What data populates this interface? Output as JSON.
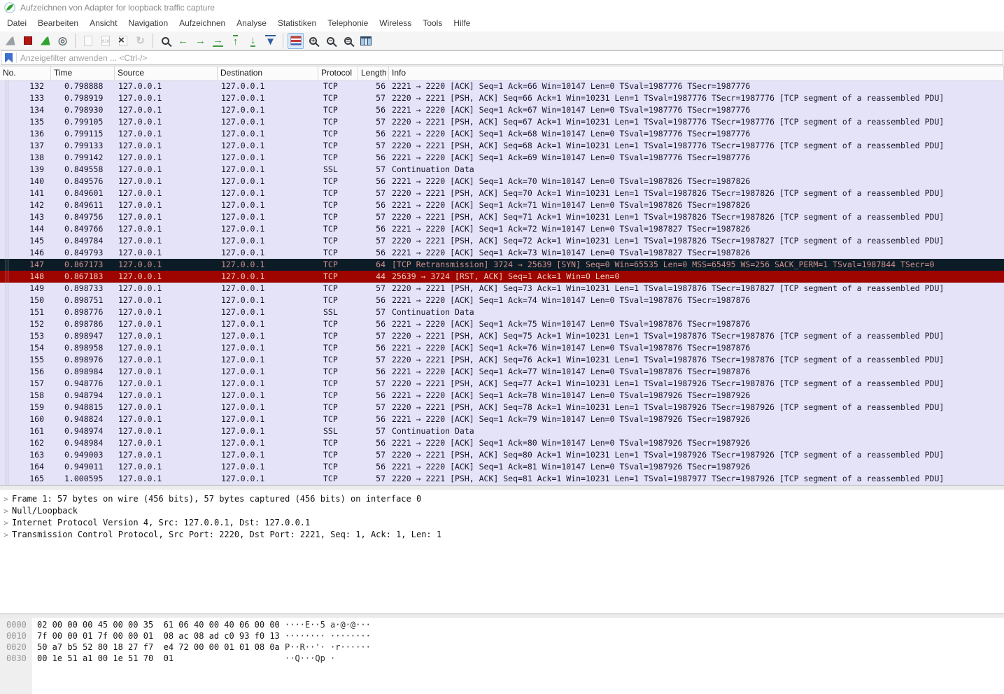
{
  "window": {
    "title": "Aufzeichnen von Adapter for loopback traffic capture"
  },
  "menu": {
    "items": [
      "Datei",
      "Bearbeiten",
      "Ansicht",
      "Navigation",
      "Aufzeichnen",
      "Analyse",
      "Statistiken",
      "Telephonie",
      "Wireless",
      "Tools",
      "Hilfe"
    ]
  },
  "toolbar": {
    "items": [
      {
        "name": "start-capture-icon",
        "kind": "fin",
        "color": "#9aa0a8",
        "enabled": false
      },
      {
        "name": "stop-capture-icon",
        "kind": "square",
        "color": "#b41414",
        "enabled": true
      },
      {
        "name": "restart-capture-icon",
        "kind": "fin",
        "color": "#2fa52f",
        "enabled": true
      },
      {
        "name": "capture-options-icon",
        "kind": "glyph",
        "glyph": "◎",
        "color": "#5f6b72",
        "enabled": true
      },
      {
        "kind": "sep"
      },
      {
        "name": "open-file-icon",
        "kind": "doc",
        "enabled": false
      },
      {
        "name": "save-file-icon",
        "kind": "doc010",
        "glyph": "010",
        "enabled": false
      },
      {
        "name": "close-file-icon",
        "kind": "docx",
        "glyph": "×",
        "enabled": true
      },
      {
        "name": "reload-file-icon",
        "kind": "glyph",
        "glyph": "↻",
        "color": "#c2c6ca",
        "enabled": false
      },
      {
        "kind": "sep"
      },
      {
        "name": "find-packet-icon",
        "kind": "mag",
        "glyph": "",
        "color": "#33383d",
        "enabled": true
      },
      {
        "name": "go-back-icon",
        "kind": "glyph",
        "glyph": "←",
        "color": "#3c9b3c",
        "enabled": true
      },
      {
        "name": "go-forward-icon",
        "kind": "glyph",
        "glyph": "→",
        "color": "#3c9b3c",
        "enabled": true
      },
      {
        "name": "go-to-packet-icon",
        "kind": "glyph",
        "glyph": "→",
        "color": "#3c9b3c",
        "bar": "bottom",
        "enabled": true
      },
      {
        "name": "first-packet-icon",
        "kind": "glyph",
        "glyph": "↑",
        "color": "#3c9b3c",
        "bar": "top",
        "enabled": true
      },
      {
        "name": "last-packet-icon",
        "kind": "glyph",
        "glyph": "↓",
        "color": "#3c9b3c",
        "bar": "bottom",
        "enabled": true
      },
      {
        "name": "auto-scroll-icon",
        "kind": "glyph",
        "glyph": "▼",
        "color": "#2f5e9e",
        "bar": "top",
        "enabled": true
      },
      {
        "kind": "sep"
      },
      {
        "name": "colorize-packets-icon",
        "kind": "lines",
        "active": true,
        "enabled": true
      },
      {
        "name": "zoom-in-icon",
        "kind": "mag",
        "glyph": "+",
        "color": "#33383d",
        "enabled": true
      },
      {
        "name": "zoom-out-icon",
        "kind": "mag",
        "glyph": "−",
        "color": "#33383d",
        "enabled": true
      },
      {
        "name": "zoom-original-icon",
        "kind": "mag",
        "glyph": "=",
        "color": "#33383d",
        "enabled": true
      },
      {
        "name": "resize-columns-icon",
        "kind": "grid",
        "enabled": true
      }
    ]
  },
  "filter": {
    "placeholder": "Anzeigefilter anwenden ... <Ctrl-/>"
  },
  "accents": {
    "row_default_bg": "#e4e3f7",
    "row_bad_bg": "#0c1c26",
    "row_bad_fg": "#cf8e8e",
    "row_rst_bg": "#9e0400",
    "row_rst_fg": "#f4cdbc"
  },
  "packet_list": {
    "columns": [
      {
        "label": "No."
      },
      {
        "label": "Time"
      },
      {
        "label": "Source"
      },
      {
        "label": "Destination"
      },
      {
        "label": "Protocol"
      },
      {
        "label": "Length"
      },
      {
        "label": "Info"
      }
    ],
    "packets": [
      {
        "no": "132",
        "time": "0.798888",
        "src": "127.0.0.1",
        "dst": "127.0.0.1",
        "proto": "TCP",
        "len": "56",
        "info": "2221 → 2220 [ACK] Seq=1 Ack=66 Win=10147 Len=0 TSval=1987776 TSecr=1987776",
        "type": "tcp"
      },
      {
        "no": "133",
        "time": "0.798919",
        "src": "127.0.0.1",
        "dst": "127.0.0.1",
        "proto": "TCP",
        "len": "57",
        "info": "2220 → 2221 [PSH, ACK] Seq=66 Ack=1 Win=10231 Len=1 TSval=1987776 TSecr=1987776 [TCP segment of a reassembled PDU]",
        "type": "tcp"
      },
      {
        "no": "134",
        "time": "0.798930",
        "src": "127.0.0.1",
        "dst": "127.0.0.1",
        "proto": "TCP",
        "len": "56",
        "info": "2221 → 2220 [ACK] Seq=1 Ack=67 Win=10147 Len=0 TSval=1987776 TSecr=1987776",
        "type": "tcp"
      },
      {
        "no": "135",
        "time": "0.799105",
        "src": "127.0.0.1",
        "dst": "127.0.0.1",
        "proto": "TCP",
        "len": "57",
        "info": "2220 → 2221 [PSH, ACK] Seq=67 Ack=1 Win=10231 Len=1 TSval=1987776 TSecr=1987776 [TCP segment of a reassembled PDU]",
        "type": "tcp"
      },
      {
        "no": "136",
        "time": "0.799115",
        "src": "127.0.0.1",
        "dst": "127.0.0.1",
        "proto": "TCP",
        "len": "56",
        "info": "2221 → 2220 [ACK] Seq=1 Ack=68 Win=10147 Len=0 TSval=1987776 TSecr=1987776",
        "type": "tcp"
      },
      {
        "no": "137",
        "time": "0.799133",
        "src": "127.0.0.1",
        "dst": "127.0.0.1",
        "proto": "TCP",
        "len": "57",
        "info": "2220 → 2221 [PSH, ACK] Seq=68 Ack=1 Win=10231 Len=1 TSval=1987776 TSecr=1987776 [TCP segment of a reassembled PDU]",
        "type": "tcp"
      },
      {
        "no": "138",
        "time": "0.799142",
        "src": "127.0.0.1",
        "dst": "127.0.0.1",
        "proto": "TCP",
        "len": "56",
        "info": "2221 → 2220 [ACK] Seq=1 Ack=69 Win=10147 Len=0 TSval=1987776 TSecr=1987776",
        "type": "tcp"
      },
      {
        "no": "139",
        "time": "0.849558",
        "src": "127.0.0.1",
        "dst": "127.0.0.1",
        "proto": "SSL",
        "len": "57",
        "info": "Continuation Data",
        "type": "ssl"
      },
      {
        "no": "140",
        "time": "0.849576",
        "src": "127.0.0.1",
        "dst": "127.0.0.1",
        "proto": "TCP",
        "len": "56",
        "info": "2221 → 2220 [ACK] Seq=1 Ack=70 Win=10147 Len=0 TSval=1987826 TSecr=1987826",
        "type": "tcp"
      },
      {
        "no": "141",
        "time": "0.849601",
        "src": "127.0.0.1",
        "dst": "127.0.0.1",
        "proto": "TCP",
        "len": "57",
        "info": "2220 → 2221 [PSH, ACK] Seq=70 Ack=1 Win=10231 Len=1 TSval=1987826 TSecr=1987826 [TCP segment of a reassembled PDU]",
        "type": "tcp"
      },
      {
        "no": "142",
        "time": "0.849611",
        "src": "127.0.0.1",
        "dst": "127.0.0.1",
        "proto": "TCP",
        "len": "56",
        "info": "2221 → 2220 [ACK] Seq=1 Ack=71 Win=10147 Len=0 TSval=1987826 TSecr=1987826",
        "type": "tcp"
      },
      {
        "no": "143",
        "time": "0.849756",
        "src": "127.0.0.1",
        "dst": "127.0.0.1",
        "proto": "TCP",
        "len": "57",
        "info": "2220 → 2221 [PSH, ACK] Seq=71 Ack=1 Win=10231 Len=1 TSval=1987826 TSecr=1987826 [TCP segment of a reassembled PDU]",
        "type": "tcp"
      },
      {
        "no": "144",
        "time": "0.849766",
        "src": "127.0.0.1",
        "dst": "127.0.0.1",
        "proto": "TCP",
        "len": "56",
        "info": "2221 → 2220 [ACK] Seq=1 Ack=72 Win=10147 Len=0 TSval=1987827 TSecr=1987826",
        "type": "tcp"
      },
      {
        "no": "145",
        "time": "0.849784",
        "src": "127.0.0.1",
        "dst": "127.0.0.1",
        "proto": "TCP",
        "len": "57",
        "info": "2220 → 2221 [PSH, ACK] Seq=72 Ack=1 Win=10231 Len=1 TSval=1987826 TSecr=1987827 [TCP segment of a reassembled PDU]",
        "type": "tcp"
      },
      {
        "no": "146",
        "time": "0.849793",
        "src": "127.0.0.1",
        "dst": "127.0.0.1",
        "proto": "TCP",
        "len": "56",
        "info": "2221 → 2220 [ACK] Seq=1 Ack=73 Win=10147 Len=0 TSval=1987827 TSecr=1987826",
        "type": "tcp"
      },
      {
        "no": "147",
        "time": "0.867173",
        "src": "127.0.0.1",
        "dst": "127.0.0.1",
        "proto": "TCP",
        "len": "64",
        "info": "[TCP Retransmission] 3724 → 25639 [SYN] Seq=0 Win=65535 Len=0 MSS=65495 WS=256 SACK_PERM=1 TSval=1987844 TSecr=0",
        "type": "bad"
      },
      {
        "no": "148",
        "time": "0.867183",
        "src": "127.0.0.1",
        "dst": "127.0.0.1",
        "proto": "TCP",
        "len": "44",
        "info": "25639 → 3724 [RST, ACK] Seq=1 Ack=1 Win=0 Len=0",
        "type": "rst"
      },
      {
        "no": "149",
        "time": "0.898733",
        "src": "127.0.0.1",
        "dst": "127.0.0.1",
        "proto": "TCP",
        "len": "57",
        "info": "2220 → 2221 [PSH, ACK] Seq=73 Ack=1 Win=10231 Len=1 TSval=1987876 TSecr=1987827 [TCP segment of a reassembled PDU]",
        "type": "tcp"
      },
      {
        "no": "150",
        "time": "0.898751",
        "src": "127.0.0.1",
        "dst": "127.0.0.1",
        "proto": "TCP",
        "len": "56",
        "info": "2221 → 2220 [ACK] Seq=1 Ack=74 Win=10147 Len=0 TSval=1987876 TSecr=1987876",
        "type": "tcp"
      },
      {
        "no": "151",
        "time": "0.898776",
        "src": "127.0.0.1",
        "dst": "127.0.0.1",
        "proto": "SSL",
        "len": "57",
        "info": "Continuation Data",
        "type": "ssl"
      },
      {
        "no": "152",
        "time": "0.898786",
        "src": "127.0.0.1",
        "dst": "127.0.0.1",
        "proto": "TCP",
        "len": "56",
        "info": "2221 → 2220 [ACK] Seq=1 Ack=75 Win=10147 Len=0 TSval=1987876 TSecr=1987876",
        "type": "tcp"
      },
      {
        "no": "153",
        "time": "0.898947",
        "src": "127.0.0.1",
        "dst": "127.0.0.1",
        "proto": "TCP",
        "len": "57",
        "info": "2220 → 2221 [PSH, ACK] Seq=75 Ack=1 Win=10231 Len=1 TSval=1987876 TSecr=1987876 [TCP segment of a reassembled PDU]",
        "type": "tcp"
      },
      {
        "no": "154",
        "time": "0.898958",
        "src": "127.0.0.1",
        "dst": "127.0.0.1",
        "proto": "TCP",
        "len": "56",
        "info": "2221 → 2220 [ACK] Seq=1 Ack=76 Win=10147 Len=0 TSval=1987876 TSecr=1987876",
        "type": "tcp"
      },
      {
        "no": "155",
        "time": "0.898976",
        "src": "127.0.0.1",
        "dst": "127.0.0.1",
        "proto": "TCP",
        "len": "57",
        "info": "2220 → 2221 [PSH, ACK] Seq=76 Ack=1 Win=10231 Len=1 TSval=1987876 TSecr=1987876 [TCP segment of a reassembled PDU]",
        "type": "tcp"
      },
      {
        "no": "156",
        "time": "0.898984",
        "src": "127.0.0.1",
        "dst": "127.0.0.1",
        "proto": "TCP",
        "len": "56",
        "info": "2221 → 2220 [ACK] Seq=1 Ack=77 Win=10147 Len=0 TSval=1987876 TSecr=1987876",
        "type": "tcp"
      },
      {
        "no": "157",
        "time": "0.948776",
        "src": "127.0.0.1",
        "dst": "127.0.0.1",
        "proto": "TCP",
        "len": "57",
        "info": "2220 → 2221 [PSH, ACK] Seq=77 Ack=1 Win=10231 Len=1 TSval=1987926 TSecr=1987876 [TCP segment of a reassembled PDU]",
        "type": "tcp"
      },
      {
        "no": "158",
        "time": "0.948794",
        "src": "127.0.0.1",
        "dst": "127.0.0.1",
        "proto": "TCP",
        "len": "56",
        "info": "2221 → 2220 [ACK] Seq=1 Ack=78 Win=10147 Len=0 TSval=1987926 TSecr=1987926",
        "type": "tcp"
      },
      {
        "no": "159",
        "time": "0.948815",
        "src": "127.0.0.1",
        "dst": "127.0.0.1",
        "proto": "TCP",
        "len": "57",
        "info": "2220 → 2221 [PSH, ACK] Seq=78 Ack=1 Win=10231 Len=1 TSval=1987926 TSecr=1987926 [TCP segment of a reassembled PDU]",
        "type": "tcp"
      },
      {
        "no": "160",
        "time": "0.948824",
        "src": "127.0.0.1",
        "dst": "127.0.0.1",
        "proto": "TCP",
        "len": "56",
        "info": "2221 → 2220 [ACK] Seq=1 Ack=79 Win=10147 Len=0 TSval=1987926 TSecr=1987926",
        "type": "tcp"
      },
      {
        "no": "161",
        "time": "0.948974",
        "src": "127.0.0.1",
        "dst": "127.0.0.1",
        "proto": "SSL",
        "len": "57",
        "info": "Continuation Data",
        "type": "ssl"
      },
      {
        "no": "162",
        "time": "0.948984",
        "src": "127.0.0.1",
        "dst": "127.0.0.1",
        "proto": "TCP",
        "len": "56",
        "info": "2221 → 2220 [ACK] Seq=1 Ack=80 Win=10147 Len=0 TSval=1987926 TSecr=1987926",
        "type": "tcp"
      },
      {
        "no": "163",
        "time": "0.949003",
        "src": "127.0.0.1",
        "dst": "127.0.0.1",
        "proto": "TCP",
        "len": "57",
        "info": "2220 → 2221 [PSH, ACK] Seq=80 Ack=1 Win=10231 Len=1 TSval=1987926 TSecr=1987926 [TCP segment of a reassembled PDU]",
        "type": "tcp"
      },
      {
        "no": "164",
        "time": "0.949011",
        "src": "127.0.0.1",
        "dst": "127.0.0.1",
        "proto": "TCP",
        "len": "56",
        "info": "2221 → 2220 [ACK] Seq=1 Ack=81 Win=10147 Len=0 TSval=1987926 TSecr=1987926",
        "type": "tcp"
      },
      {
        "no": "165",
        "time": "1.000595",
        "src": "127.0.0.1",
        "dst": "127.0.0.1",
        "proto": "TCP",
        "len": "57",
        "info": "2220 → 2221 [PSH, ACK] Seq=81 Ack=1 Win=10231 Len=1 TSval=1987977 TSecr=1987926 [TCP segment of a reassembled PDU]",
        "type": "tcp"
      }
    ]
  },
  "details": {
    "lines": [
      "Frame 1: 57 bytes on wire (456 bits), 57 bytes captured (456 bits) on interface 0",
      "Null/Loopback",
      "Internet Protocol Version 4, Src: 127.0.0.1, Dst: 127.0.0.1",
      "Transmission Control Protocol, Src Port: 2220, Dst Port: 2221, Seq: 1, Ack: 1, Len: 1"
    ]
  },
  "hex": {
    "rows": [
      {
        "offset": "0000",
        "bytes": "02 00 00 00 45 00 00 35  61 06 40 00 40 06 00 00",
        "ascii": "····E··5 a·@·@···"
      },
      {
        "offset": "0010",
        "bytes": "7f 00 00 01 7f 00 00 01  08 ac 08 ad c0 93 f0 13",
        "ascii": "········ ········"
      },
      {
        "offset": "0020",
        "bytes": "50 a7 b5 52 80 18 27 f7  e4 72 00 00 01 01 08 0a",
        "ascii": "P··R··'· ·r······"
      },
      {
        "offset": "0030",
        "bytes": "00 1e 51 a1 00 1e 51 70  01",
        "ascii": "··Q···Qp ·"
      }
    ]
  }
}
